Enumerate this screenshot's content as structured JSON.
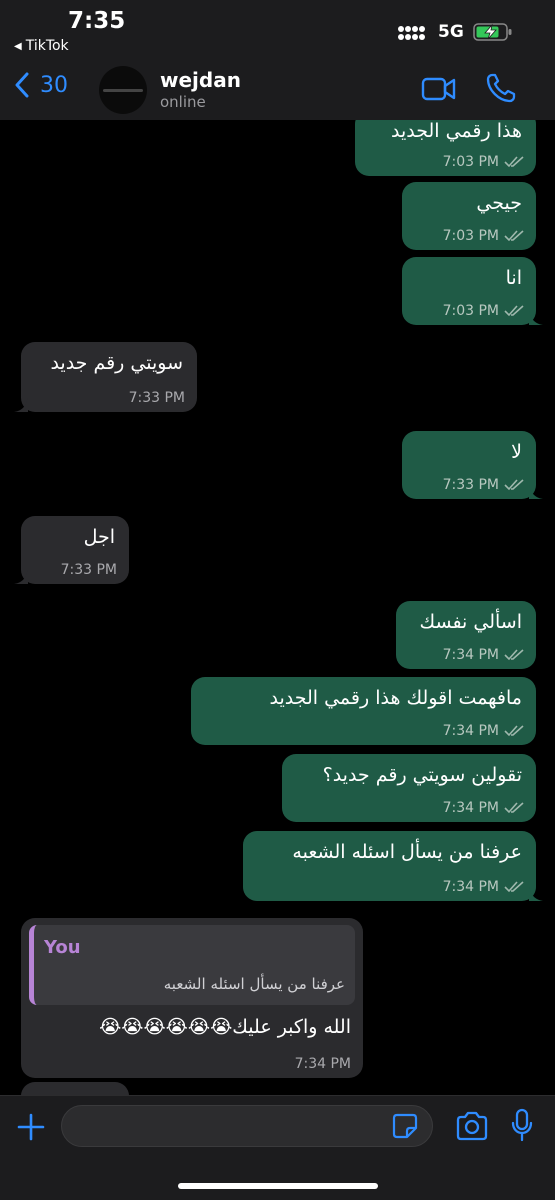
{
  "status_bar": {
    "time": "7:35",
    "back_app": "TikTok",
    "network": "5G"
  },
  "header": {
    "back_count": "30",
    "contact_name": "wejdan",
    "contact_status": "online"
  },
  "messages": [
    {
      "dir": "out",
      "text": "هذا رقمي الجديد",
      "time": "7:03 PM"
    },
    {
      "dir": "out",
      "text": "جيجي",
      "time": "7:03 PM"
    },
    {
      "dir": "out",
      "text": "انا",
      "time": "7:03 PM"
    },
    {
      "dir": "in",
      "text": "سويتي رقم جديد",
      "time": "7:33 PM"
    },
    {
      "dir": "out",
      "text": "لا",
      "time": "7:33 PM"
    },
    {
      "dir": "in",
      "text": "اجل",
      "time": "7:33 PM"
    },
    {
      "dir": "out",
      "text": "اسألي نفسك",
      "time": "7:34 PM"
    },
    {
      "dir": "out",
      "text": "مافهمت اقولك هذا رقمي الجديد",
      "time": "7:34 PM"
    },
    {
      "dir": "out",
      "text": "تقولين سويتي رقم جديد؟",
      "time": "7:34 PM"
    },
    {
      "dir": "out",
      "text": "عرفنا من يسأل اسئله الشعبه",
      "time": "7:34 PM"
    },
    {
      "dir": "in",
      "text": "الله واكبر عليك😭😭😭😭😭😭",
      "time": "7:34 PM",
      "reply": {
        "author": "You",
        "text": "عرفنا من يسأل اسئله الشعبه"
      }
    }
  ],
  "composer": {
    "placeholder": ""
  },
  "colors": {
    "outgoing_bubble": "#1f5b46",
    "incoming_bubble": "#2b2b2e",
    "accent_blue": "#2f8cff",
    "reply_accent": "#b784d6"
  },
  "icons": [
    "back-chevron-icon",
    "video-call-icon",
    "phone-icon",
    "plus-icon",
    "sticker-icon",
    "camera-icon",
    "microphone-icon",
    "double-check-icon"
  ]
}
